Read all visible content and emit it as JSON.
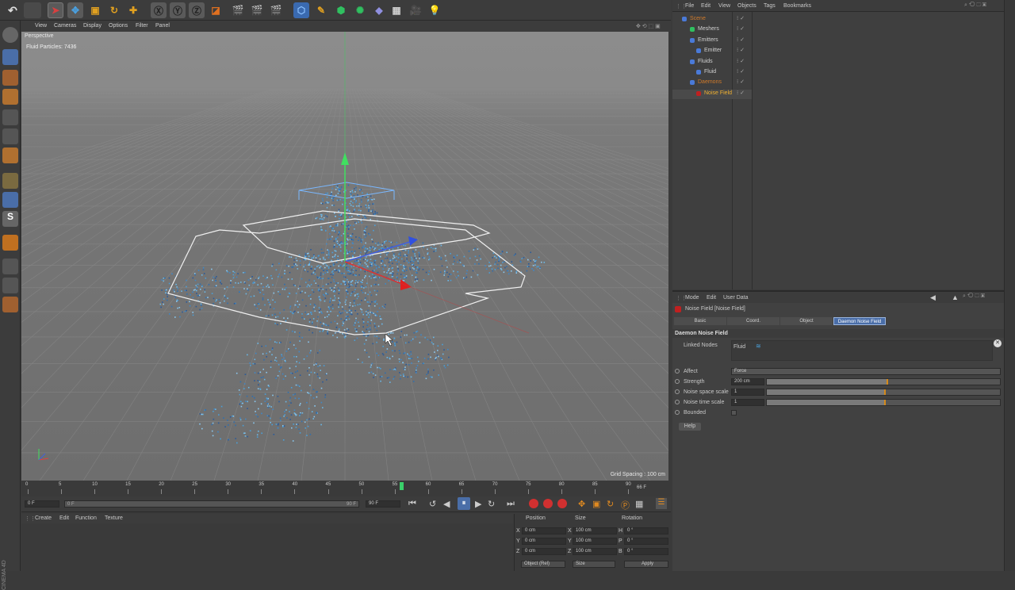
{
  "viewport": {
    "menu": [
      "View",
      "Cameras",
      "Display",
      "Options",
      "Filter",
      "Panel"
    ],
    "camera_label": "Perspective",
    "hud": "Fluid Particles: 7436",
    "grid_spacing": "Grid Spacing : 100 cm"
  },
  "timeline": {
    "ticks": [
      "0",
      "5",
      "10",
      "15",
      "20",
      "25",
      "30",
      "35",
      "40",
      "45",
      "50",
      "55",
      "60",
      "65",
      "70",
      "75",
      "80",
      "85",
      "90"
    ],
    "end_label": "66 F",
    "current_frame_fraction": 0.617,
    "start_field": "0 F",
    "min_field": "0 F",
    "range_end_field": "90 F",
    "max_field": "90 F"
  },
  "materials": {
    "menu": [
      "Create",
      "Edit",
      "Function",
      "Texture"
    ]
  },
  "coordinates": {
    "headers": [
      "Position",
      "Size",
      "Rotation"
    ],
    "rows": [
      {
        "axis": "X",
        "pos": "0 cm",
        "size_axis": "X",
        "size": "100 cm",
        "rot_axis": "H",
        "rot": "0 °"
      },
      {
        "axis": "Y",
        "pos": "0 cm",
        "size_axis": "Y",
        "size": "100 cm",
        "rot_axis": "P",
        "rot": "0 °"
      },
      {
        "axis": "Z",
        "pos": "0 cm",
        "size_axis": "Z",
        "size": "100 cm",
        "rot_axis": "B",
        "rot": "0 °"
      }
    ],
    "mode": "Object (Rel)",
    "size_mode": "Size",
    "apply": "Apply"
  },
  "object_manager": {
    "menu": [
      "File",
      "Edit",
      "View",
      "Objects",
      "Tags",
      "Bookmarks"
    ],
    "items": [
      {
        "label": "Scene",
        "color": "#d07a2a"
      },
      {
        "label": "Meshers",
        "color": "#d0d0d0"
      },
      {
        "label": "Emitters",
        "color": "#d0d0d0"
      },
      {
        "label": "Emitter",
        "color": "#d0d0d0"
      },
      {
        "label": "Fluids",
        "color": "#d0d0d0"
      },
      {
        "label": "Fluid",
        "color": "#d0d0d0"
      },
      {
        "label": "Daemons",
        "color": "#d07a2a"
      },
      {
        "label": "Noise Field",
        "color": "#f0b030"
      }
    ]
  },
  "attributes": {
    "menu": [
      "Mode",
      "Edit",
      "User Data"
    ],
    "object_title": "Noise Field [Noise Field]",
    "tabs": [
      "Basic",
      "Coord.",
      "Object",
      "Daemon Noise Field"
    ],
    "section": "Daemon Noise Field",
    "linked_nodes_label": "Linked Nodes",
    "linked_node": "Fluid",
    "params": [
      {
        "label": "Affect",
        "value": "Force",
        "type": "dropdown"
      },
      {
        "label": "Strength",
        "value": "200 cm",
        "type": "slider",
        "fill": 0.52
      },
      {
        "label": "Noise space scale",
        "value": "1",
        "type": "slider",
        "fill": 0.51
      },
      {
        "label": "Noise time scale",
        "value": "1",
        "type": "slider",
        "fill": 0.51
      },
      {
        "label": "Bounded",
        "value": "",
        "type": "checkbox"
      }
    ],
    "help": "Help"
  },
  "brand": "CINEMA 4D",
  "colors": {
    "accent": "#4a6ea8",
    "slider_mark": "#d58a1a",
    "particles": "#4a9fd8"
  }
}
